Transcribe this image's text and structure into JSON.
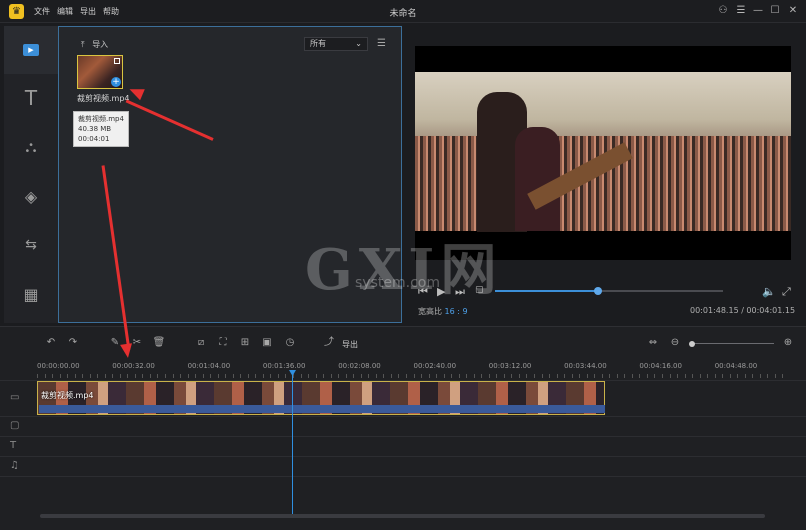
{
  "app": {
    "title": "未命名",
    "menus": [
      "文件",
      "编辑",
      "导出",
      "帮助"
    ]
  },
  "media": {
    "import_label": "导入",
    "filter": "所有",
    "file_name": "裁剪视频.mp4",
    "tooltip": {
      "name": "裁剪视频.mp4",
      "size": "40.38 MB",
      "duration": "00:04:01"
    }
  },
  "preview": {
    "aspect_label": "宽高比",
    "aspect_value": "16 : 9",
    "time": "00:01:48.15 / 00:04:01.15",
    "progress": 0.45
  },
  "timeline": {
    "export_label": "导出",
    "ruler": [
      "00:00:00.00",
      "00:00:32.00",
      "00:01:04.00",
      "00:01:36.00",
      "00:02:08.00",
      "00:02:40.00",
      "00:03:12.00",
      "00:03:44.00",
      "00:04:16.00",
      "00:04:48.00"
    ],
    "clip_name": "裁剪视频.mp4"
  },
  "watermark": {
    "main": "GXI网",
    "sub": "system.com"
  },
  "colors": {
    "accent": "#2f8fe0",
    "highlight": "#d9c540",
    "arrow": "#e53030"
  }
}
